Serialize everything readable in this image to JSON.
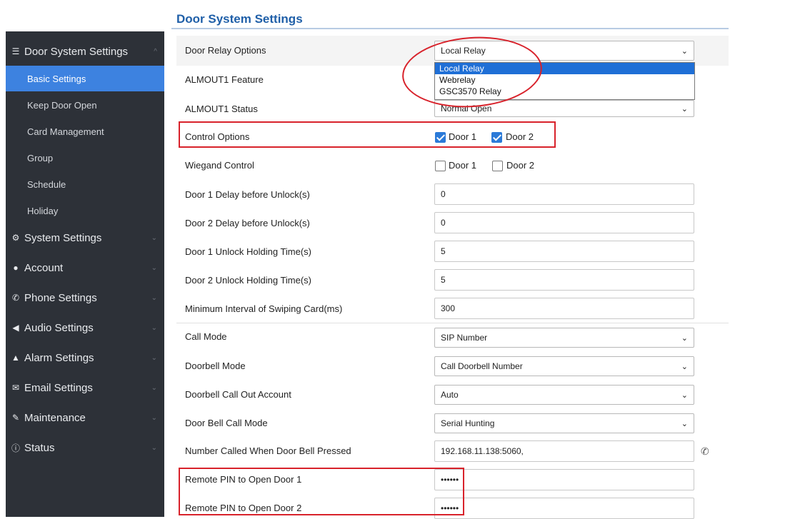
{
  "page_title": "Door System Settings",
  "sidebar": {
    "sections": [
      {
        "label": "Door System Settings",
        "icon": "list-icon",
        "chevron": "^"
      },
      {
        "label": "System Settings",
        "icon": "gear-icon",
        "chevron": "v"
      },
      {
        "label": "Account",
        "icon": "person-icon",
        "chevron": "v"
      },
      {
        "label": "Phone Settings",
        "icon": "phone-icon",
        "chevron": "v"
      },
      {
        "label": "Audio Settings",
        "icon": "speaker-icon",
        "chevron": "v"
      },
      {
        "label": "Alarm Settings",
        "icon": "warning-icon",
        "chevron": "v"
      },
      {
        "label": "Email Settings",
        "icon": "email-icon",
        "chevron": "v"
      },
      {
        "label": "Maintenance",
        "icon": "wrench-icon",
        "chevron": "v"
      },
      {
        "label": "Status",
        "icon": "info-icon",
        "chevron": "v"
      }
    ],
    "subitems": [
      "Basic Settings",
      "Keep Door Open",
      "Card Management",
      "Group",
      "Schedule",
      "Holiday"
    ],
    "active_subitem": "Basic Settings"
  },
  "form": {
    "door_relay": {
      "label": "Door Relay Options",
      "value": "Local Relay",
      "options": [
        "Local Relay",
        "Webrelay",
        "GSC3570 Relay"
      ]
    },
    "almout1_feature": {
      "label": "ALMOUT1 Feature"
    },
    "almout1_status": {
      "label": "ALMOUT1 Status",
      "value": "Normal Open"
    },
    "control_options": {
      "label": "Control Options",
      "door1": "Door 1",
      "door2": "Door 2",
      "door1_checked": true,
      "door2_checked": true
    },
    "wiegand_control": {
      "label": "Wiegand Control",
      "door1": "Door 1",
      "door2": "Door 2",
      "door1_checked": false,
      "door2_checked": false
    },
    "door1_delay": {
      "label": "Door 1 Delay before Unlock(s)",
      "value": "0"
    },
    "door2_delay": {
      "label": "Door 2 Delay before Unlock(s)",
      "value": "0"
    },
    "door1_holding": {
      "label": "Door 1 Unlock Holding Time(s)",
      "value": "5"
    },
    "door2_holding": {
      "label": "Door 2 Unlock Holding Time(s)",
      "value": "5"
    },
    "min_interval": {
      "label": "Minimum Interval of Swiping Card(ms)",
      "value": "300"
    },
    "call_mode": {
      "label": "Call Mode",
      "value": "SIP Number"
    },
    "doorbell_mode": {
      "label": "Doorbell Mode",
      "value": "Call Doorbell Number"
    },
    "doorbell_account": {
      "label": "Doorbell Call Out Account",
      "value": "Auto"
    },
    "doorbell_call_mode": {
      "label": "Door Bell Call Mode",
      "value": "Serial Hunting"
    },
    "number_called": {
      "label": "Number Called When Door Bell Pressed",
      "value": "192.168.11.138:5060,"
    },
    "pin_door1": {
      "label": "Remote PIN to Open Door 1",
      "value": "••••••"
    },
    "pin_door2": {
      "label": "Remote PIN to Open Door 2",
      "value": "••••••"
    }
  },
  "colors": {
    "sidebar_bg": "#2d3138",
    "active_item": "#3d82e0",
    "title": "#1f5fa8",
    "highlight_red": "#d8222b",
    "checkbox_blue": "#2b7ad8"
  }
}
